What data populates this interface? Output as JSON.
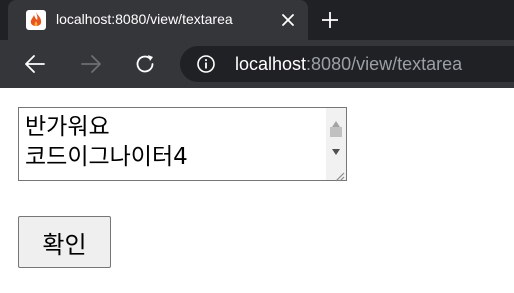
{
  "browser": {
    "tab": {
      "title": "localhost:8080/view/textarea",
      "favicon": "flame-icon"
    },
    "toolbar": {
      "back": "arrow-left-icon",
      "forward": "arrow-right-icon",
      "reload": "reload-icon"
    },
    "address_bar": {
      "host": "localhost",
      "rest": ":8080/view/textarea",
      "icon": "info-icon"
    },
    "colors": {
      "tabstrip_bg": "#202124",
      "toolbar_bg": "#35363a",
      "omnibox_bg": "#202124",
      "url_dim": "#9aa0a6"
    }
  },
  "page": {
    "textarea": {
      "value": "반가워요\n코드이그나이터4"
    },
    "submit_button": {
      "label": "확인"
    }
  }
}
